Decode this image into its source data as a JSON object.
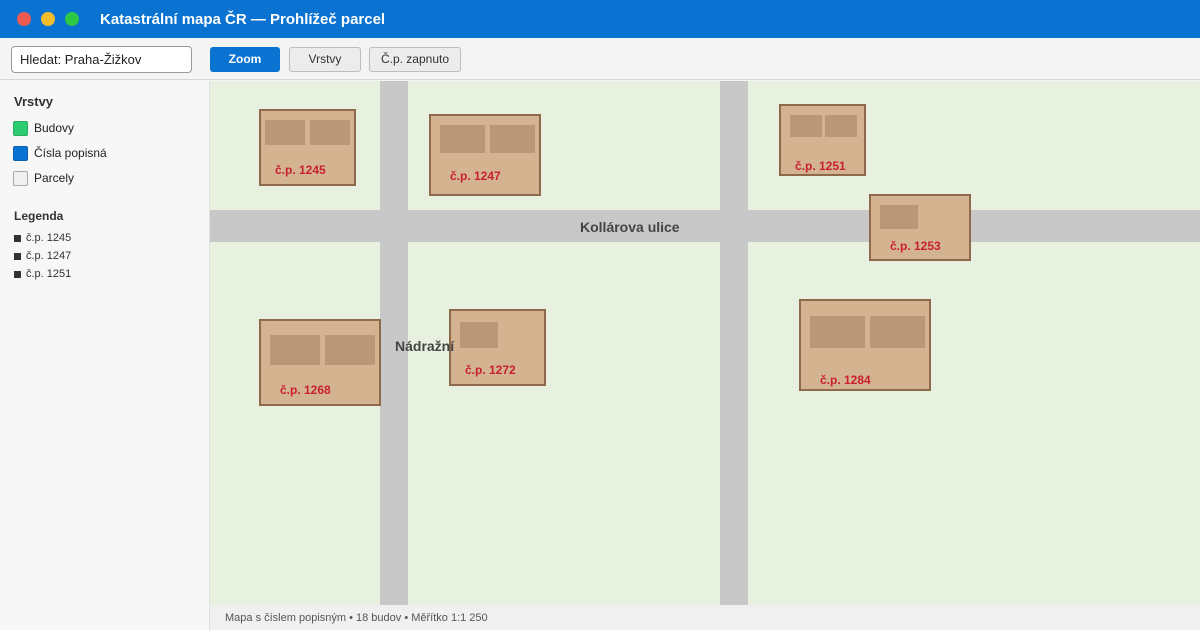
{
  "window": {
    "title": "Katastrální mapa ČR — Prohlížeč parcel"
  },
  "toolbar": {
    "search_value": "Hledat: Praha-Žižkov",
    "zoom_label": "Zoom",
    "layers_label": "Vrstvy",
    "cp_label": "Č.p. zapnuto"
  },
  "sidebar": {
    "layers_heading": "Vrstvy",
    "layers": [
      {
        "label": "Budovy",
        "color": "#2ecc71"
      },
      {
        "label": "Čísla popisná",
        "color": "#0a72d1"
      },
      {
        "label": "Parcely",
        "color": "#f0f0f0"
      }
    ],
    "legend_heading": "Legenda",
    "legend": [
      "č.p. 1245",
      "č.p. 1247",
      "č.p. 1251"
    ]
  },
  "map": {
    "streets": {
      "horizontal": "Kollárova ulice",
      "vertical": "Nádražní"
    },
    "buildings": [
      "č.p. 1245",
      "č.p. 1247",
      "č.p. 1251",
      "č.p. 1253",
      "č.p. 1268",
      "č.p. 1272",
      "č.p. 1284"
    ]
  },
  "status": {
    "text": "Mapa s číslem popisným • 18 budov • Měřítko 1:1 250"
  }
}
